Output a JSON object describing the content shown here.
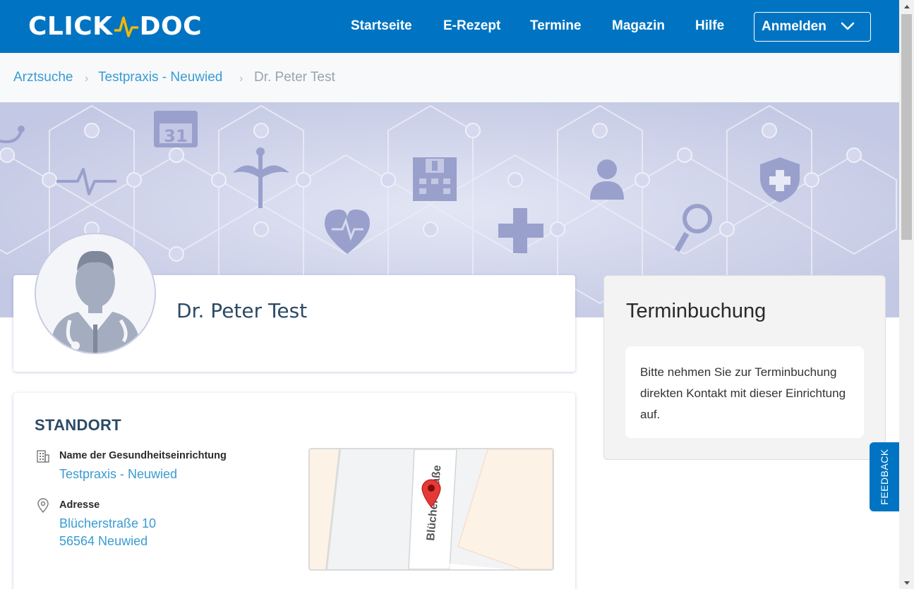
{
  "header": {
    "logo_left": "CLICK",
    "logo_right": "DOC",
    "nav": [
      "Startseite",
      "E-Rezept",
      "Termine",
      "Magazin",
      "Hilfe"
    ],
    "login_label": "Anmelden"
  },
  "breadcrumb": {
    "items": [
      "Arztsuche",
      "Testpraxis - Neuwied",
      "Dr. Peter Test"
    ],
    "separator": "›"
  },
  "profile": {
    "name": "Dr. Peter Test"
  },
  "booking": {
    "title": "Terminbuchung",
    "message": "Bitte nehmen Sie zur Terminbuchung direkten Kontakt mit dieser Einrichtung auf."
  },
  "standort": {
    "title": "STANDORT",
    "facility_label": "Name der Gesundheitseinrichtung",
    "facility_value": "Testpraxis - Neuwied",
    "address_label": "Adresse",
    "address_line1": "Blücherstraße 10",
    "address_line2": "56564 Neuwied",
    "map_street": "Blücherstraße"
  },
  "feedback_label": "FEEDBACK",
  "colors": {
    "brand": "#0074c2",
    "accent_logo": "#f5b700",
    "link": "#3a9bd1",
    "heading": "#2c4a66"
  }
}
